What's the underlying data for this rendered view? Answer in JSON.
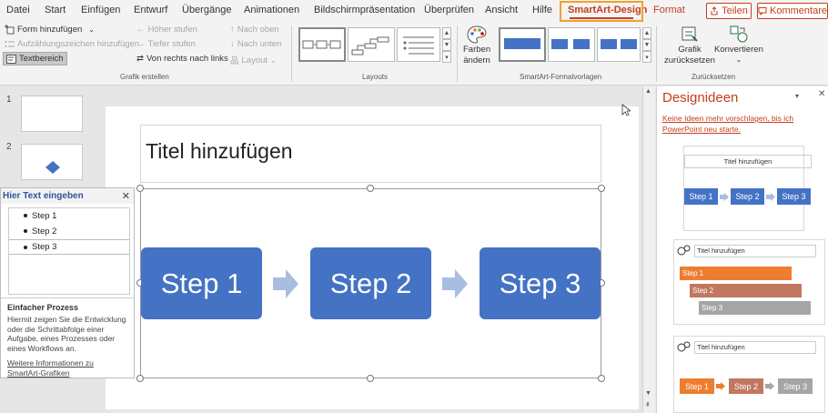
{
  "tabs": [
    "Datei",
    "Start",
    "Einfügen",
    "Entwurf",
    "Übergänge",
    "Animationen",
    "Bildschirmpräsentation",
    "Überprüfen",
    "Ansicht",
    "Hilfe"
  ],
  "active_tab": "SmartArt-Design",
  "format_tab": "Format",
  "share_label": "Teilen",
  "comment_label": "Kommentare",
  "ribbon": {
    "add_shape": "Form hinzufügen",
    "add_bullet": "Aufzählungszeichen hinzufügen",
    "text_pane": "Textbereich",
    "promote": "Höher stufen",
    "demote": "Tiefer stufen",
    "rtl": "Von rechts nach links",
    "move_up": "Nach oben",
    "move_down": "Nach unten",
    "layout": "Layout",
    "group_create": "Grafik erstellen",
    "group_layouts": "Layouts",
    "change_colors_1": "Farben",
    "change_colors_2": "ändern",
    "group_styles": "SmartArt-Formatvorlagen",
    "reset_1": "Grafik",
    "reset_2": "zurücksetzen",
    "convert": "Konvertieren",
    "group_reset": "Zurücksetzen"
  },
  "slides": [
    {
      "number": "1"
    },
    {
      "number": "2"
    }
  ],
  "text_pane": {
    "header": "Hier Text eingeben",
    "items": [
      "Step 1",
      "Step 2",
      "Step 3"
    ],
    "desc_title": "Einfacher Prozess",
    "desc_text": "Hiermit zeigen Sie die Entwicklung oder die Schrittabfolge einer Aufgabe, eines Prozesses oder eines Workflows an.",
    "more_link": "Weitere Informationen zu SmartArt-Grafiken"
  },
  "slide": {
    "title_placeholder": "Titel hinzufügen",
    "steps": [
      "Step 1",
      "Step 2",
      "Step 3"
    ]
  },
  "designer": {
    "title": "Designideen",
    "link": "Keine Ideen mehr vorschlagen, bis ich PowerPoint neu starte.",
    "card_title": "Titel hinzufügen",
    "steps": [
      "Step 1",
      "Step 2",
      "Step 3"
    ]
  },
  "colors": {
    "accent": "#c43e1c",
    "step_blue": "#4472c4",
    "step_orange": "#ed7d31",
    "step_red": "#c0785f",
    "step_gray": "#a5a5a5"
  }
}
